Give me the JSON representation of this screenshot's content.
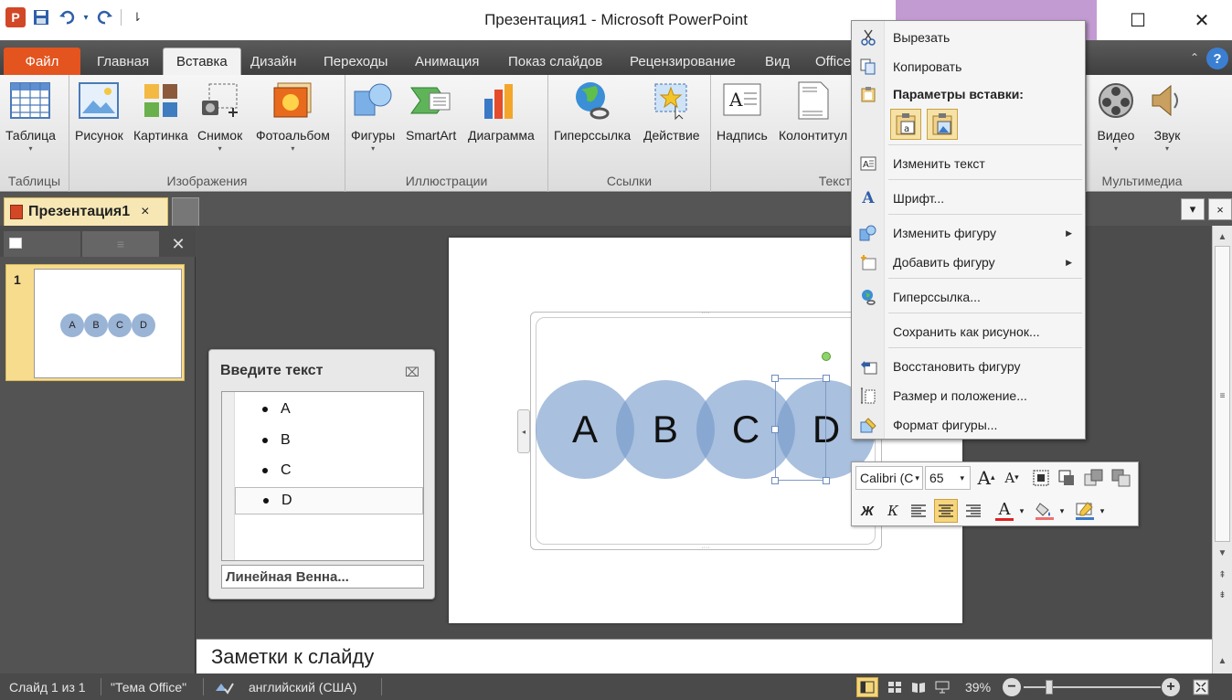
{
  "window": {
    "title": "Презентация1  -  Microsoft PowerPoint",
    "logo_letter": "P",
    "minimize_glyph": "—",
    "maximize_glyph": "☐",
    "close_glyph": "✕"
  },
  "qat": {
    "dropdown_glyph": "▾",
    "customize_glyph": "⇂"
  },
  "tabs": [
    {
      "label": "Файл"
    },
    {
      "label": "Главная"
    },
    {
      "label": "Вставка"
    },
    {
      "label": "Дизайн"
    },
    {
      "label": "Переходы"
    },
    {
      "label": "Анимация"
    },
    {
      "label": "Показ слайдов"
    },
    {
      "label": "Рецензирование"
    },
    {
      "label": "Вид"
    },
    {
      "label": "Office"
    }
  ],
  "help_label": "?",
  "ribbon_minimize_glyph": "⌃",
  "ribbon": {
    "groups": {
      "tables": "Таблицы",
      "images": "Изображения",
      "illustrations": "Иллюстрации",
      "links": "Ссылки",
      "text": "Текст",
      "media": "Мультимедиа"
    },
    "buttons": {
      "table": "Таблица",
      "picture": "Рисунок",
      "clipart": "Картинка",
      "screenshot": "Снимок",
      "photoalbum": "Фотоальбом",
      "shapes": "Фигуры",
      "smartart": "SmartArt",
      "chart": "Диаграмма",
      "hyperlink": "Гиперссылка",
      "action": "Действие",
      "textbox": "Надпись",
      "header": "Колонтитул",
      "video": "Видео",
      "audio": "Звук"
    },
    "dropdown_glyph": "▾"
  },
  "document": {
    "tab_label": "Презентация1",
    "tab_close": "×",
    "ctl_dropdown": "▾",
    "ctl_close": "×"
  },
  "slides_panel": {
    "close_glyph": "✕",
    "slide_number": "1",
    "thumb_labels": [
      "A",
      "B",
      "C",
      "D"
    ]
  },
  "slide": {
    "circles": [
      "A",
      "B",
      "C",
      "D"
    ],
    "grip_glyph": "····",
    "expand_glyph": "◂"
  },
  "text_pane": {
    "title": "Введите текст",
    "close_glyph": "⌧",
    "items": [
      "A",
      "B",
      "C",
      "D"
    ],
    "footer": "Линейная Венна..."
  },
  "notes_placeholder": "Заметки к слайду",
  "scrollbar": {
    "up_glyph": "▲",
    "down_glyph": "▼",
    "prev_glyph": "⇞",
    "next_glyph": "⇟",
    "grip_glyph": "≡"
  },
  "statusbar": {
    "slide_info": "Слайд 1 из 1",
    "theme": "\"Тема Office\"",
    "language": "английский (США)",
    "zoom": "39%",
    "zoom_out_glyph": "−",
    "zoom_in_glyph": "+"
  },
  "context_menu": {
    "cut": "Вырезать",
    "copy": "Копировать",
    "paste_header": "Параметры вставки:",
    "edit_text": "Изменить текст",
    "font": "Шрифт...",
    "change_shape": "Изменить фигуру",
    "add_shape": "Добавить фигуру",
    "hyperlink": "Гиперссылка...",
    "save_as_picture": "Сохранить как рисунок...",
    "reset_shape": "Восстановить фигуру",
    "size_position": "Размер и положение...",
    "format_shape": "Формат фигуры...",
    "submenu_glyph": "▶"
  },
  "mini_toolbar": {
    "font_name": "Calibri (С",
    "font_size": "65",
    "dropdown_glyph": "▾",
    "grow_font": "A",
    "shrink_font": "A",
    "bold": "Ж",
    "italic": "К",
    "font_color_glyph": "A"
  },
  "colors": {
    "file_tab": "#e3541f",
    "circle_fill": "#7499ca",
    "selection_yellow": "#f6d57c",
    "title_accent": "#c39bd3"
  }
}
